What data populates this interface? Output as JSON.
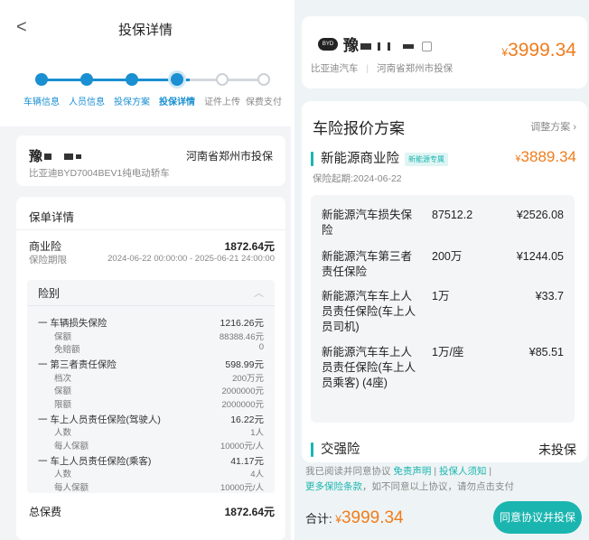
{
  "left": {
    "nav_title": "投保详情",
    "back_glyph": "<",
    "steps": [
      {
        "label": "车辆信息",
        "state": "done"
      },
      {
        "label": "人员信息",
        "state": "done"
      },
      {
        "label": "投保方案",
        "state": "done"
      },
      {
        "label": "投保详情",
        "state": "current"
      },
      {
        "label": "证件上传",
        "state": "todo"
      },
      {
        "label": "保费支付",
        "state": "todo"
      }
    ],
    "vehicle": {
      "plate_prefix": "豫",
      "location": "河南省郑州市投保",
      "model": "比亚迪BYD7004BEV1纯电动轿车"
    },
    "policy": {
      "section_title": "保单详情",
      "commercial_label": "商业险",
      "commercial_amount": "1872.64元",
      "period_label": "保险期限",
      "period_value": "2024-06-22 00:00:00 - 2025-06-21 24:00:00",
      "coverage_header": "险别",
      "coverages": [
        {
          "kind": "main",
          "label": "一 车辆损失保险",
          "value": "1216.26元"
        },
        {
          "kind": "sub",
          "label": "保额",
          "value": "88388.46元"
        },
        {
          "kind": "sub",
          "label": "免赔额",
          "value": "0"
        },
        {
          "kind": "main",
          "label": "一 第三者责任保险",
          "value": "598.99元"
        },
        {
          "kind": "sub",
          "label": "档次",
          "value": "200万元"
        },
        {
          "kind": "sub",
          "label": "保额",
          "value": "2000000元"
        },
        {
          "kind": "sub",
          "label": "限额",
          "value": "2000000元"
        },
        {
          "kind": "main",
          "label": "一 车上人员责任保险(驾驶人)",
          "value": "16.22元"
        },
        {
          "kind": "sub",
          "label": "人数",
          "value": "1人"
        },
        {
          "kind": "sub",
          "label": "每人保额",
          "value": "10000元/人"
        },
        {
          "kind": "main",
          "label": "一 车上人员责任保险(乘客)",
          "value": "41.17元"
        },
        {
          "kind": "sub",
          "label": "人数",
          "value": "4人"
        },
        {
          "kind": "sub",
          "label": "每人保额",
          "value": "10000元/人"
        }
      ],
      "total_label": "总保费",
      "total_amount": "1872.64元"
    }
  },
  "right": {
    "plate_prefix": "豫",
    "brand_badge": "BYD",
    "brand": "比亚迪汽车",
    "location": "河南省郑州市投保",
    "currency": "¥",
    "top_price": "3999.34",
    "plan_title": "车险报价方案",
    "adjust_label": "调整方案",
    "commercial": {
      "title": "新能源商业险",
      "tag": "新能源专属",
      "price": "3889.34",
      "start": "保险起期:2024-06-22",
      "items": [
        {
          "name": "新能源汽车损失保险",
          "amount": "87512.2",
          "price": "¥2526.08"
        },
        {
          "name": "新能源汽车第三者责任保险",
          "amount": "200万",
          "price": "¥1244.05"
        },
        {
          "name": "新能源汽车车上人员责任保险(车上人员司机)",
          "amount": "1万",
          "price": "¥33.7"
        },
        {
          "name": "新能源汽车车上人员责任保险(车上人员乘客) (4座)",
          "amount": "1万/座",
          "price": "¥85.51"
        }
      ]
    },
    "compulsory": {
      "title": "交强险",
      "status": "未投保"
    },
    "agreement": {
      "prefix": "我已阅读并同意协议 ",
      "link1": "免责声明",
      "sep1": " | ",
      "link2": "投保人须知",
      "sep2": " | ",
      "link3": "更多保险条款",
      "suffix": "，如不同意以上协议，请勿点击支付"
    },
    "total_label": "合计:",
    "total_price": "3999.34",
    "pay_label": "同意协议并投保"
  },
  "colors": {
    "accent_blue": "#1a8fd1",
    "accent_teal": "#1bb5b0",
    "price_orange": "#f07c1c"
  }
}
